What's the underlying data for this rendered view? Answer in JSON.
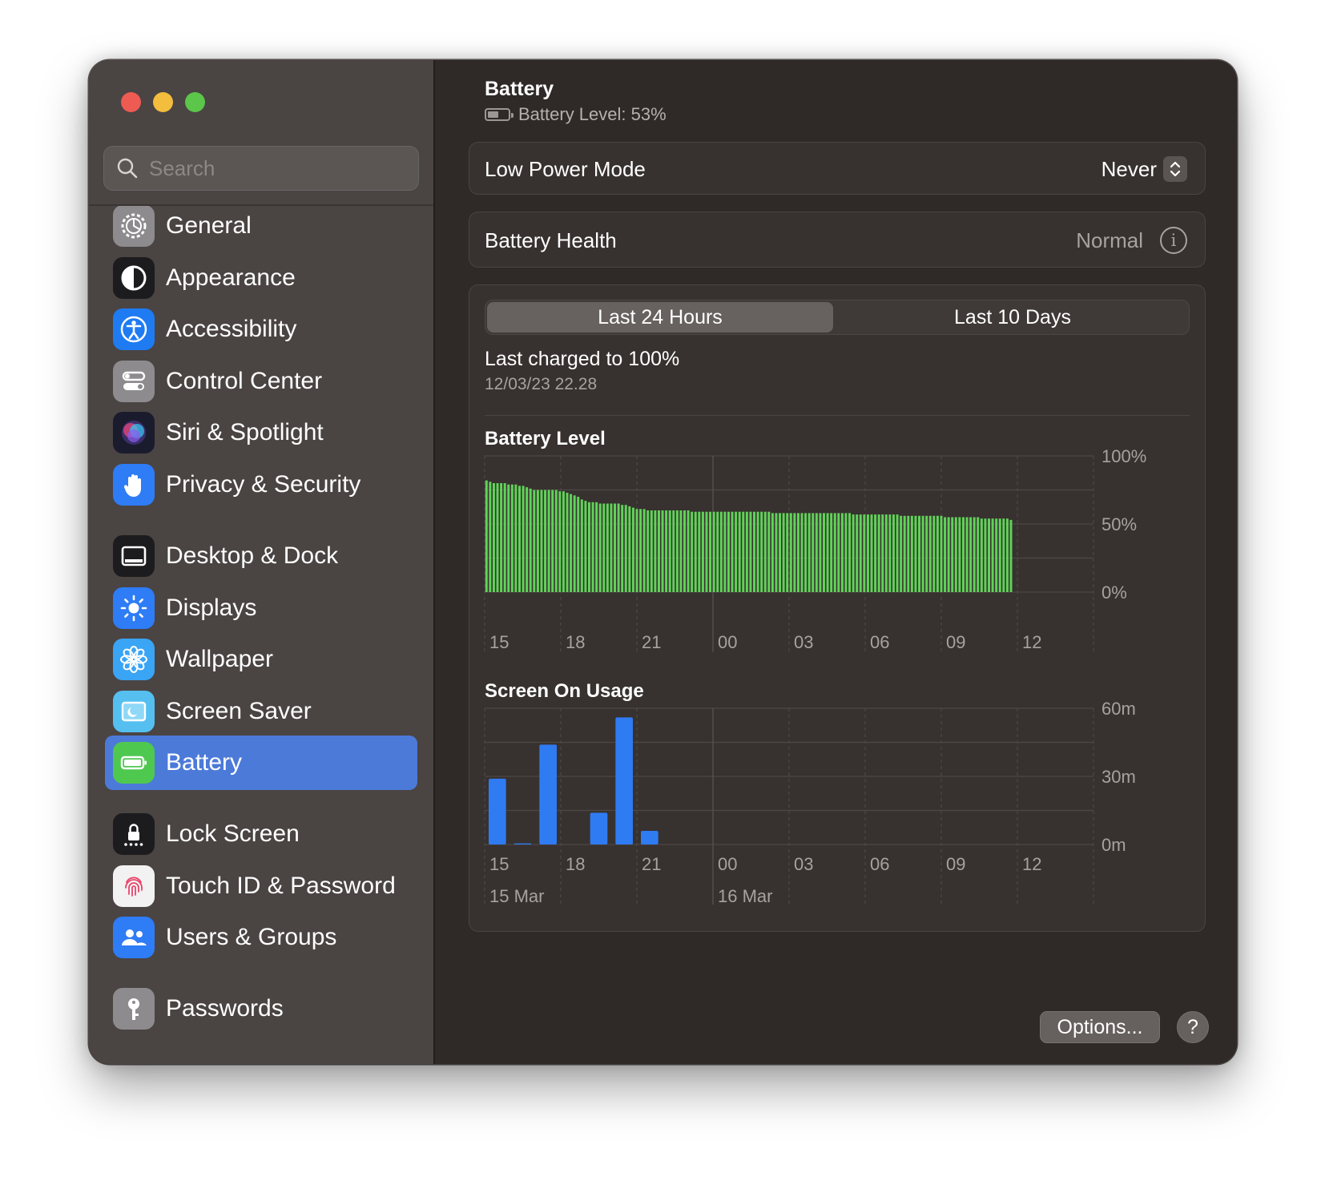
{
  "window": {
    "title": "Battery"
  },
  "sidebar": {
    "search_placeholder": "Search",
    "items": [
      {
        "label": "General",
        "icon": "gear-icon",
        "color": "#8e8e93"
      },
      {
        "label": "Appearance",
        "icon": "appearance-icon",
        "color": "#1c1c1e"
      },
      {
        "label": "Accessibility",
        "icon": "accessibility-icon",
        "color": "#1a7bf0"
      },
      {
        "label": "Control Center",
        "icon": "control-center-icon",
        "color": "#8e8e93"
      },
      {
        "label": "Siri & Spotlight",
        "icon": "siri-icon",
        "color": "#2b2b55"
      },
      {
        "label": "Privacy & Security",
        "icon": "hand-icon",
        "color": "#2e7cf6"
      },
      {
        "label": "Desktop & Dock",
        "icon": "desktop-dock-icon",
        "color": "#1c1c1e"
      },
      {
        "label": "Displays",
        "icon": "sun-icon",
        "color": "#2e7cf6"
      },
      {
        "label": "Wallpaper",
        "icon": "flower-icon",
        "color": "#3aa4f5"
      },
      {
        "label": "Screen Saver",
        "icon": "screen-saver-icon",
        "color": "#55bff0"
      },
      {
        "label": "Battery",
        "icon": "battery-icon",
        "color": "#4fc84f",
        "selected": true
      },
      {
        "label": "Lock Screen",
        "icon": "lock-icon",
        "color": "#1c1c1e"
      },
      {
        "label": "Touch ID & Password",
        "icon": "fingerprint-icon",
        "color": "#f2f2f2"
      },
      {
        "label": "Users & Groups",
        "icon": "users-icon",
        "color": "#2e7cf6"
      },
      {
        "label": "Passwords",
        "icon": "key-icon",
        "color": "#8e8e93"
      }
    ]
  },
  "main": {
    "title": "Battery",
    "battery_level_text": "Battery Level: 53%",
    "battery_level": 53,
    "low_power_mode": {
      "label": "Low Power Mode",
      "value": "Never"
    },
    "battery_health": {
      "label": "Battery Health",
      "value": "Normal",
      "info": "i"
    },
    "tabs": [
      {
        "label": "Last 24 Hours",
        "active": true
      },
      {
        "label": "Last 10 Days",
        "active": false
      }
    ],
    "last_charged": {
      "title": "Last charged to 100%",
      "date": "12/03/23 22.28"
    },
    "options_label": "Options...",
    "help_label": "?",
    "colors": {
      "battery_bar": "#61d25a",
      "usage_bar": "#2f7bf2",
      "accent": "#4c7ad9"
    }
  },
  "chart_data": [
    {
      "type": "bar",
      "title": "Battery Level",
      "x_ticks": [
        "15",
        "18",
        "21",
        "00",
        "03",
        "06",
        "09",
        "12"
      ],
      "y_ticks": [
        "100%",
        "50%",
        "0%"
      ],
      "ylim": [
        0,
        100
      ],
      "grid": true,
      "values": [
        82,
        81,
        80,
        80,
        80,
        80,
        79,
        79,
        79,
        78,
        78,
        77,
        76,
        75,
        75,
        75,
        75,
        75,
        75,
        75,
        74,
        74,
        73,
        72,
        71,
        70,
        68,
        67,
        66,
        66,
        66,
        65,
        65,
        65,
        65,
        65,
        65,
        64,
        64,
        63,
        62,
        61,
        61,
        61,
        60,
        60,
        60,
        60,
        60,
        60,
        60,
        60,
        60,
        60,
        60,
        60,
        59,
        59,
        59,
        59,
        59,
        59,
        59,
        59,
        59,
        59,
        59,
        59,
        59,
        59,
        59,
        59,
        59,
        59,
        59,
        59,
        59,
        59,
        58,
        58,
        58,
        58,
        58,
        58,
        58,
        58,
        58,
        58,
        58,
        58,
        58,
        58,
        58,
        58,
        58,
        58,
        58,
        58,
        58,
        58,
        57,
        57,
        57,
        57,
        57,
        57,
        57,
        57,
        57,
        57,
        57,
        57,
        57,
        56,
        56,
        56,
        56,
        56,
        56,
        56,
        56,
        56,
        56,
        56,
        56,
        55,
        55,
        55,
        55,
        55,
        55,
        55,
        55,
        55,
        55,
        54,
        54,
        54,
        54,
        54,
        54,
        54,
        54,
        53
      ]
    },
    {
      "type": "bar",
      "title": "Screen On Usage",
      "x_ticks": [
        "15",
        "18",
        "21",
        "00",
        "03",
        "06",
        "09",
        "12"
      ],
      "date_labels": [
        "15 Mar",
        "16 Mar"
      ],
      "y_ticks": [
        "60m",
        "30m",
        "0m"
      ],
      "ylim": [
        0,
        60
      ],
      "grid": true,
      "unit": "minutes",
      "values": [
        29,
        0.5,
        44,
        0,
        14,
        56,
        6,
        0,
        0,
        0,
        0,
        0,
        0,
        0,
        0,
        0,
        0,
        0,
        0,
        0,
        0,
        0,
        0,
        0
      ]
    }
  ]
}
